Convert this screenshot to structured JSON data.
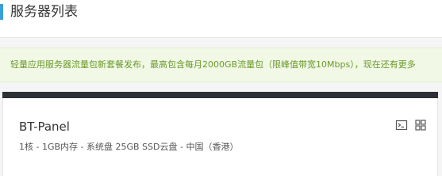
{
  "header": {
    "title": "服务器列表",
    "accent_color": "#3aa0d8"
  },
  "notice": {
    "text": "轻量应用服务器流量包新套餐发布，最高包含每月2000GB流量包（限峰值带宽10Mbps），现在还有更多",
    "text_color": "#6a9a2b",
    "background_color": "#f1f8e6"
  },
  "server_card": {
    "name": "BT-Panel",
    "specs": "1核 - 1GB内存 - 系统盘 25GB SSD云盘 - 中国（香港）",
    "topbar_color": "#2d3035",
    "actions": [
      {
        "icon": "terminal-icon"
      },
      {
        "icon": "grid-icon"
      }
    ]
  }
}
